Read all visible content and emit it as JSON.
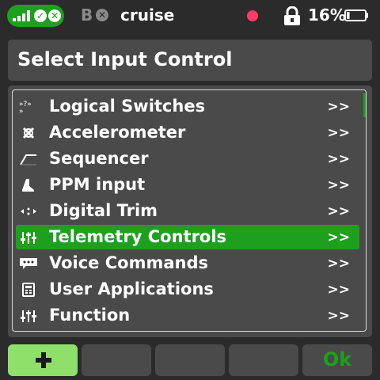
{
  "status_bar": {
    "receiver_icons": [
      "signal-icon",
      "check-icon",
      "close-icon"
    ],
    "model_prefix": "B",
    "model_name": "cruise",
    "battery_percent": "16%",
    "battery_level": 0.16
  },
  "title": "Select Input Control",
  "list": {
    "arrow": ">>",
    "selected_index": 5,
    "items": [
      {
        "label": "Logical Switches",
        "icon": "logical-switch-icon"
      },
      {
        "label": "Accelerometer",
        "icon": "accelerometer-icon"
      },
      {
        "label": "Sequencer",
        "icon": "sequencer-icon"
      },
      {
        "label": "PPM input",
        "icon": "ppm-input-icon"
      },
      {
        "label": "Digital Trim",
        "icon": "digital-trim-icon"
      },
      {
        "label": "Telemetry Controls",
        "icon": "sliders-icon"
      },
      {
        "label": "Voice Commands",
        "icon": "speech-bubble-icon"
      },
      {
        "label": "User Applications",
        "icon": "calculator-icon"
      },
      {
        "label": "Function",
        "icon": "sliders-icon"
      }
    ]
  },
  "buttons": {
    "add_icon": "plus-icon",
    "ok_label": "Ok"
  },
  "colors": {
    "accent": "#1ea01e",
    "add_button": "#8ee06a",
    "panel": "#4a4a4a",
    "background": "#2b2b2b",
    "record_dot": "#ff3b6b"
  }
}
